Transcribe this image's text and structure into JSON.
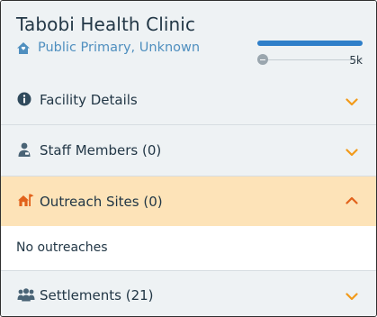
{
  "facility": {
    "name": "Tabobi Health Clinic",
    "type": "Public Primary, Unknown"
  },
  "meter": {
    "max_label": "5k",
    "fill_fraction": 1.0
  },
  "sections": [
    {
      "label": "Facility Details",
      "icon": "info-icon",
      "expanded": false
    },
    {
      "label": "Staff Members (0)",
      "icon": "person-icon",
      "expanded": false
    },
    {
      "label": "Outreach Sites (0)",
      "icon": "outreach-house-icon",
      "expanded": true
    },
    {
      "label": "Settlements (21)",
      "icon": "group-icon",
      "expanded": false
    }
  ],
  "outreach": {
    "empty_text": "No outreaches"
  },
  "colors": {
    "accent_orange": "#f29a1a",
    "active_section_bg": "#fde3b8",
    "brand_blue": "#2f7fc9"
  }
}
